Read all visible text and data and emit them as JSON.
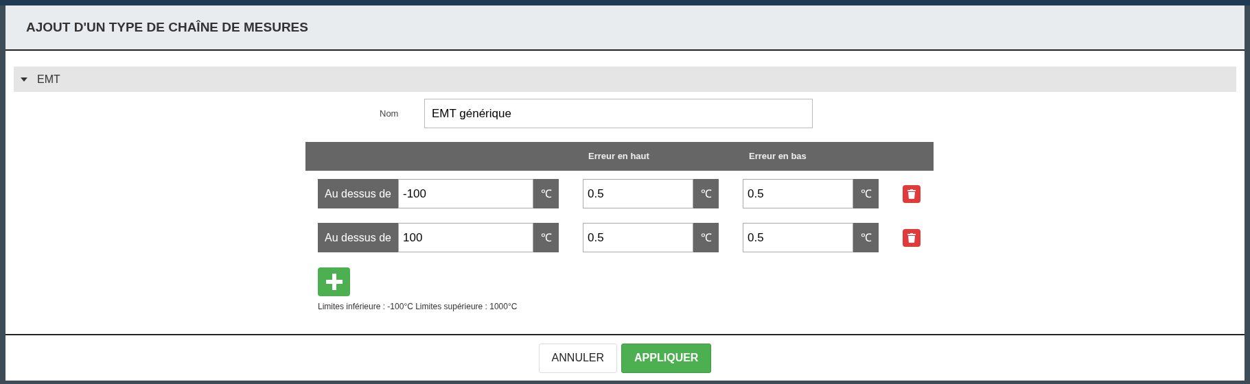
{
  "dialog": {
    "title": "AJOUT D'UN TYPE DE CHAÎNE DE MESURES",
    "section": {
      "title": "EMT",
      "expanded": true
    },
    "name_label": "Nom",
    "name_value": "EMT générique",
    "columns": [
      "Erreur en haut",
      "Erreur en bas"
    ],
    "rows": [
      {
        "label": "Au dessus de",
        "value": "-100",
        "unit": "℃",
        "high": "0.5",
        "high_unit": "℃",
        "low": "0.5",
        "low_unit": "℃"
      },
      {
        "label": "Au dessus de",
        "value": "100",
        "unit": "℃",
        "high": "0.5",
        "high_unit": "℃",
        "low": "0.5",
        "low_unit": "℃"
      }
    ],
    "limits": "Limites inférieure : -100°C Limites supérieure : 1000°C",
    "buttons": [
      {
        "label": "ANNULER",
        "kind": "secondary"
      },
      {
        "label": "APPLIQUER",
        "kind": "primary"
      }
    ]
  }
}
